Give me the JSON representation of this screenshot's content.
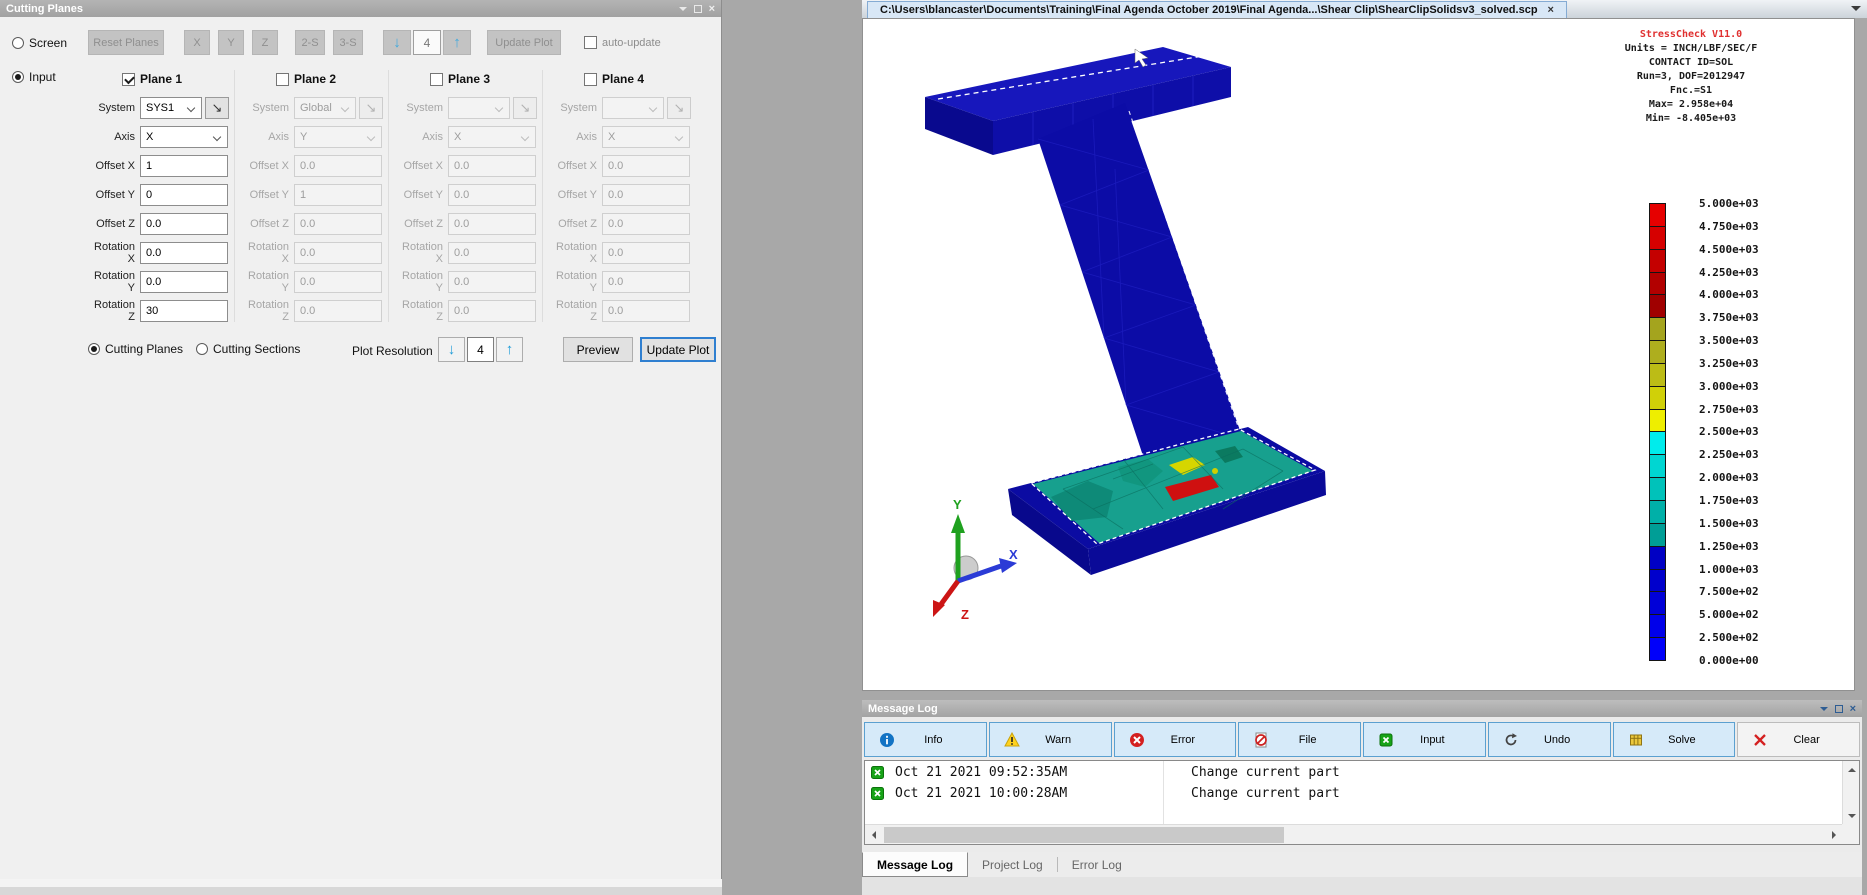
{
  "left_panel": {
    "title": "Cutting Planes",
    "modes": {
      "screen_label": "Screen",
      "input_label": "Input"
    },
    "toolbar": {
      "reset_planes": "Reset Planes",
      "x": "X",
      "y": "Y",
      "z": "Z",
      "two_s": "2-S",
      "three_s": "3-S",
      "spinner_value": "4",
      "update_plot": "Update Plot",
      "auto_update": "auto-update"
    },
    "field_labels": {
      "system": "System",
      "axis": "Axis",
      "offset_x": "Offset X",
      "offset_y": "Offset Y",
      "offset_z": "Offset Z",
      "rotation_x": "Rotation X",
      "rotation_y": "Rotation Y",
      "rotation_z": "Rotation Z"
    },
    "planes": [
      {
        "label": "Plane 1",
        "checked": true,
        "enabled": true,
        "system": "SYS1",
        "axis": "X",
        "offset_x": "1",
        "offset_y": "0",
        "offset_z": "0.0",
        "rotation_x": "0.0",
        "rotation_y": "0.0",
        "rotation_z": "30"
      },
      {
        "label": "Plane 2",
        "checked": false,
        "enabled": false,
        "system": "Global",
        "axis": "Y",
        "offset_x": "0.0",
        "offset_y": "1",
        "offset_z": "0.0",
        "rotation_x": "0.0",
        "rotation_y": "0.0",
        "rotation_z": "0.0"
      },
      {
        "label": "Plane 3",
        "checked": false,
        "enabled": false,
        "system": "",
        "axis": "X",
        "offset_x": "0.0",
        "offset_y": "0.0",
        "offset_z": "0.0",
        "rotation_x": "0.0",
        "rotation_y": "0.0",
        "rotation_z": "0.0"
      },
      {
        "label": "Plane 4",
        "checked": false,
        "enabled": false,
        "system": "",
        "axis": "X",
        "offset_x": "0.0",
        "offset_y": "0.0",
        "offset_z": "0.0",
        "rotation_x": "0.0",
        "rotation_y": "0.0",
        "rotation_z": "0.0"
      }
    ],
    "bottom": {
      "cutting_planes": "Cutting Planes",
      "cutting_sections": "Cutting Sections",
      "plot_resolution": "Plot Resolution",
      "resolution_value": "4",
      "preview": "Preview",
      "update_plot": "Update Plot"
    }
  },
  "document_tab": {
    "path": "C:\\Users\\blancaster\\Documents\\Training\\Final Agenda October 2019\\Final Agenda...\\Shear Clip\\ShearClipSolidsv3_solved.scp"
  },
  "viewport": {
    "info": {
      "title": "StressCheck V11.0",
      "title_color": "#e03030",
      "lines": [
        "Units = INCH/LBF/SEC/F",
        "CONTACT ID=SOL",
        "Run=3, DOF=2012947",
        "Fnc.=S1",
        "Max= 2.958e+04",
        "Min= -8.405e+03"
      ]
    },
    "triad": {
      "x": "X",
      "y": "Y",
      "z": "Z",
      "x_color": "#2b3bd6",
      "y_color": "#1fa11f",
      "z_color": "#cc1515"
    },
    "legend": {
      "labels": [
        "5.000e+03",
        "4.750e+03",
        "4.500e+03",
        "4.250e+03",
        "4.000e+03",
        "3.750e+03",
        "3.500e+03",
        "3.250e+03",
        "3.000e+03",
        "2.750e+03",
        "2.500e+03",
        "2.250e+03",
        "2.000e+03",
        "1.750e+03",
        "1.500e+03",
        "1.250e+03",
        "1.000e+03",
        "7.500e+02",
        "5.000e+02",
        "2.500e+02",
        "0.000e+00"
      ],
      "colors": [
        "#e60000",
        "#d60000",
        "#c40000",
        "#b20000",
        "#a00000",
        "#a4a41e",
        "#aeae1e",
        "#bcbc16",
        "#d0d008",
        "#eeee00",
        "#00ecec",
        "#00d6d2",
        "#00c2ba",
        "#00b0a8",
        "#009e96",
        "#0000c4",
        "#0000cc",
        "#0000d8",
        "#0000ea",
        "#0000fa"
      ]
    },
    "model_base_color": "#0c0ca6"
  },
  "message_log": {
    "title": "Message Log",
    "buttons": [
      {
        "label": "Info"
      },
      {
        "label": "Warn"
      },
      {
        "label": "Error"
      },
      {
        "label": "File"
      },
      {
        "label": "Input"
      },
      {
        "label": "Undo"
      },
      {
        "label": "Solve"
      },
      {
        "label": "Clear"
      }
    ],
    "rows": [
      {
        "time": "Oct 21 2021 09:52:35AM",
        "message": "Change current part"
      },
      {
        "time": "Oct 21 2021 10:00:28AM",
        "message": "Change current part"
      }
    ],
    "tabs": [
      {
        "label": "Message Log",
        "active": true
      },
      {
        "label": "Project Log",
        "active": false
      },
      {
        "label": "Error Log",
        "active": false
      }
    ]
  }
}
